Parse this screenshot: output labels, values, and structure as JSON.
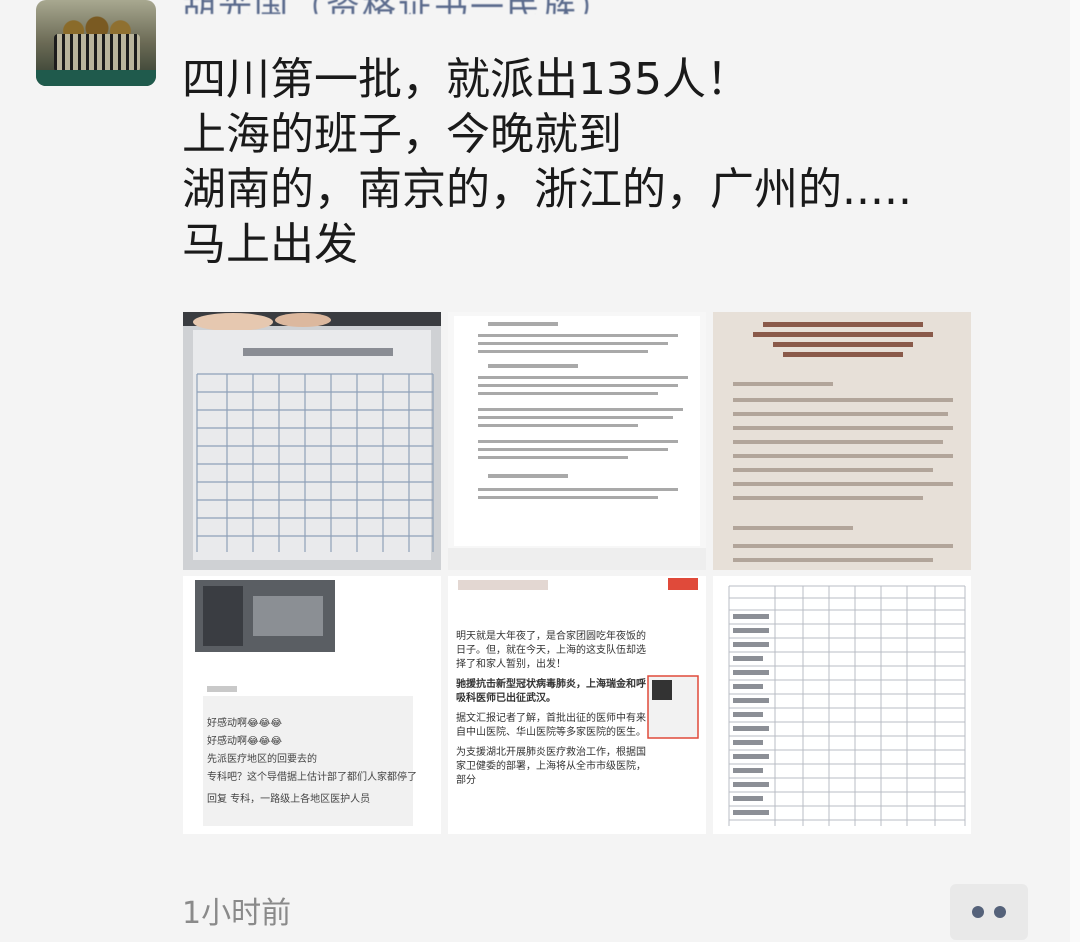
{
  "post": {
    "author_name": "胡光国（资格证书一民族）",
    "lines": [
      "四川第一批，就派出135人！",
      "上海的班子，今晚就到",
      "湖南的，南京的，浙江的，广州的.....",
      "马上出发"
    ],
    "timestamp": "1小时前"
  },
  "images": [
    {
      "name": "image-sichuan-table",
      "kind": "photo-of-table"
    },
    {
      "name": "image-notice-document",
      "kind": "document"
    },
    {
      "name": "image-hunan-notice",
      "kind": "document"
    },
    {
      "name": "image-chat-screenshot",
      "kind": "screenshot"
    },
    {
      "name": "image-news-article",
      "kind": "screenshot"
    },
    {
      "name": "image-staff-table",
      "kind": "table"
    }
  ],
  "news_article": {
    "para1": "明天就是大年夜了，是合家团圆吃年夜饭的日子。但，就在今天，上海的这支队伍却选择了和家人暂别，出发！",
    "para2_bold": "驰援抗击新型冠状病毒肺炎，上海瑞金和呼吸科医师已出征武汉。",
    "para3": "据文汇报记者了解，首批出征的医师中有来自中山医院、华山医院等多家医院的医生。",
    "para4": "为支援湖北开展肺炎医疗救治工作，根据国家卫健委的部署，上海将从全市市级医院，部分"
  },
  "chat_screenshot": {
    "msg1": "好感动啊😂😂😂",
    "msg2": "好感动啊😂😂😂",
    "msg3": "先派医疗地区的回要去的",
    "msg4": "专科吧？这个导借据上估计部了都们人家都停了",
    "msg5": "回复     专科，一路级上各地区医护人员"
  },
  "colors": {
    "background": "#f4f4f4",
    "author": "#5a6a8c",
    "text": "#1a1a1a",
    "timestamp": "#8a8a8a",
    "more_button": "#e9e9e9",
    "more_dots": "#55627a"
  },
  "icons": {
    "more": "more-dots-icon"
  }
}
